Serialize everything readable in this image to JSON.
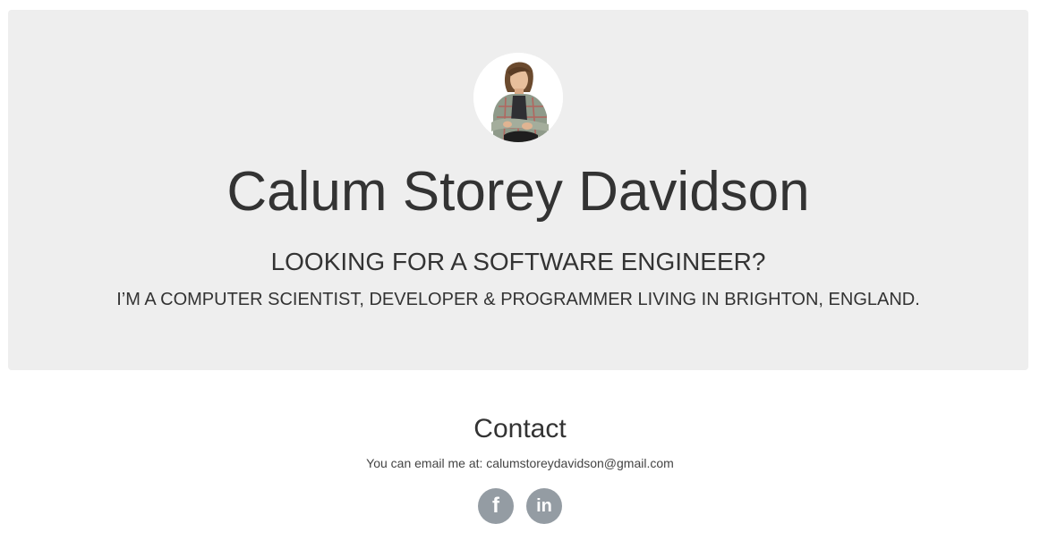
{
  "hero": {
    "name": "Calum Storey Davidson",
    "headline": "LOOKING FOR A SOFTWARE ENGINEER?",
    "tagline": "I’M A COMPUTER SCIENTIST, DEVELOPER & PROGRAMMER LIVING IN BRIGHTON, ENGLAND."
  },
  "contact": {
    "title": "Contact",
    "text": "You can email me at: calumstoreydavidson@gmail.com",
    "socials": [
      {
        "icon": "facebook-icon",
        "glyph": "f"
      },
      {
        "icon": "linkedin-icon",
        "glyph": "in"
      }
    ]
  },
  "colors": {
    "hero_background": "#eeeeee",
    "text": "#333333",
    "social_button": "#949ca3"
  }
}
